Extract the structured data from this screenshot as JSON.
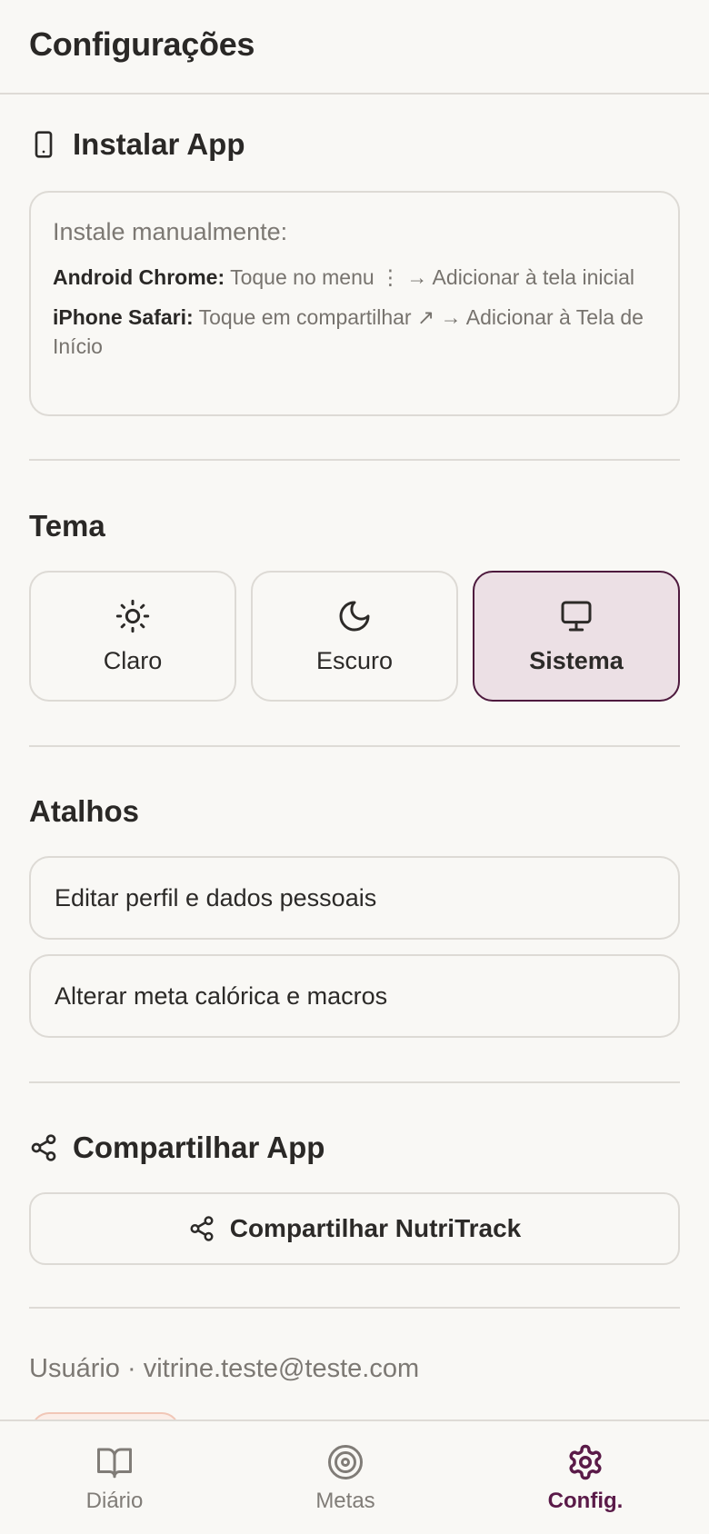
{
  "header": {
    "title": "Configurações"
  },
  "install": {
    "title": "Instalar App",
    "icon": "smartphone-icon",
    "intro": "Instale manualmente:",
    "android_label": "Android Chrome:",
    "android_text": "Toque no menu ⋮ → Adicionar à tela inicial",
    "iphone_label": "iPhone Safari:",
    "iphone_text": "Toque em compartilhar ↗ → Adicionar à Tela de Início"
  },
  "theme": {
    "title": "Tema",
    "options": [
      {
        "label": "Claro",
        "icon": "sun-icon",
        "selected": false
      },
      {
        "label": "Escuro",
        "icon": "moon-icon",
        "selected": false
      },
      {
        "label": "Sistema",
        "icon": "monitor-icon",
        "selected": true
      }
    ]
  },
  "shortcuts": {
    "title": "Atalhos",
    "items": [
      {
        "label": "Editar perfil e dados pessoais"
      },
      {
        "label": "Alterar meta calórica e macros"
      }
    ]
  },
  "share": {
    "title": "Compartilhar App",
    "icon": "share-icon",
    "button_label": "Compartilhar NutriTrack"
  },
  "account": {
    "user_line": "Usuário · vitrine.teste@teste.com"
  },
  "bottom_nav": {
    "items": [
      {
        "label": "Diário",
        "icon": "book-icon",
        "active": false
      },
      {
        "label": "Metas",
        "icon": "target-icon",
        "active": false
      },
      {
        "label": "Config.",
        "icon": "gear-icon",
        "active": true
      }
    ]
  },
  "colors": {
    "accent": "#5a1a48",
    "selected_background": "#ece0e5",
    "background": "#f9f8f5",
    "border": "#dddad5"
  }
}
